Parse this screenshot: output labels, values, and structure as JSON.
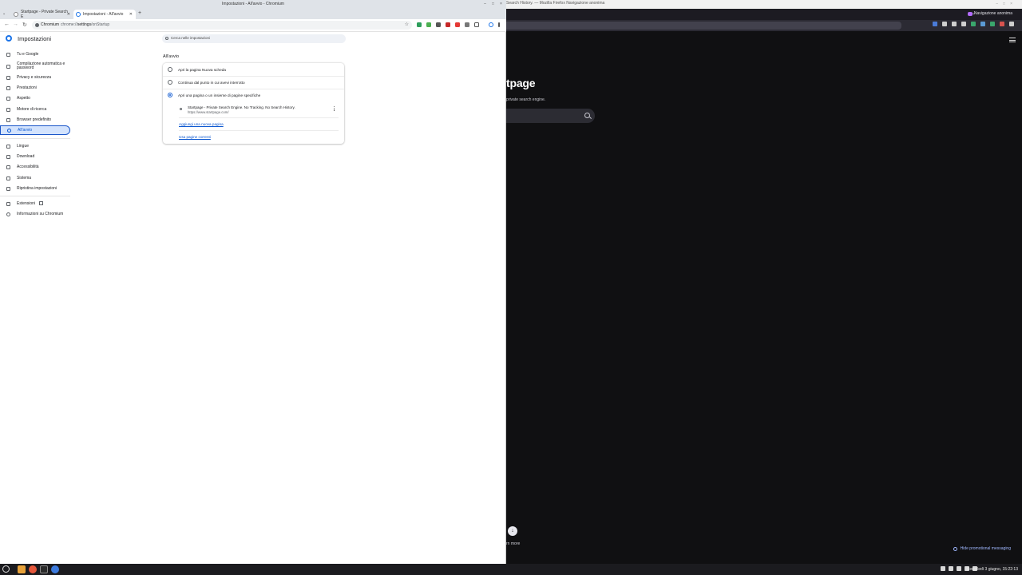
{
  "chromium": {
    "window_title": "Impostazioni - All'avvio - Chromium",
    "tabs": [
      {
        "title": "Startpage - Private Search E"
      },
      {
        "title": "Impostazioni - All'avvio"
      }
    ],
    "omnibox": {
      "chip": "Chromium",
      "url_prefix": "chrome://",
      "url_host": "settings",
      "url_path": "/onStartup"
    },
    "settings": {
      "title": "Impostazioni",
      "search_placeholder": "Cerca nelle impostazioni",
      "nav": [
        {
          "label": "Tu e Google"
        },
        {
          "label": "Compilazione automatica e password"
        },
        {
          "label": "Privacy e sicurezza"
        },
        {
          "label": "Prestazioni"
        },
        {
          "label": "Aspetto"
        },
        {
          "label": "Motore di ricerca"
        },
        {
          "label": "Browser predefinito"
        },
        {
          "label": "All'avvio"
        },
        {
          "label": "Lingue"
        },
        {
          "label": "Download"
        },
        {
          "label": "Accessibilità"
        },
        {
          "label": "Sistema"
        },
        {
          "label": "Ripristina impostazioni"
        },
        {
          "label": "Estensioni"
        },
        {
          "label": "Informazioni su Chromium"
        }
      ],
      "section_title": "All'avvio",
      "options": [
        {
          "label": "Apri la pagina Nuova scheda",
          "selected": false
        },
        {
          "label": "Continua dal punto in cui avevi interrotto",
          "selected": false
        },
        {
          "label": "Apri una pagina o un insieme di pagine specifiche",
          "selected": true
        }
      ],
      "startup_page": {
        "title": "Startpage - Private Search Engine. No Tracking. No Search History.",
        "url": "https://www.startpage.com/"
      },
      "add_page_link": "Aggiungi una nuova pagina",
      "use_current_link": "Usa pagine correnti"
    }
  },
  "firefox": {
    "window_title": "Search History. — Mozilla Firefox Navigazione anonima",
    "private_label": "Navigazione anonima",
    "page": {
      "logo": "tpage",
      "tagline": "private search engine.",
      "learn_more": "rn more",
      "hide_promo": "Hide promotional messaging"
    }
  },
  "taskbar": {
    "clock": "Mercoledì 3 giugno, 15:22:13"
  },
  "colors": {
    "accent": "#0b57d0",
    "active_nav_bg": "#d3e3fd",
    "firefox_bg": "#101012",
    "private_purple": "#b36cff"
  }
}
